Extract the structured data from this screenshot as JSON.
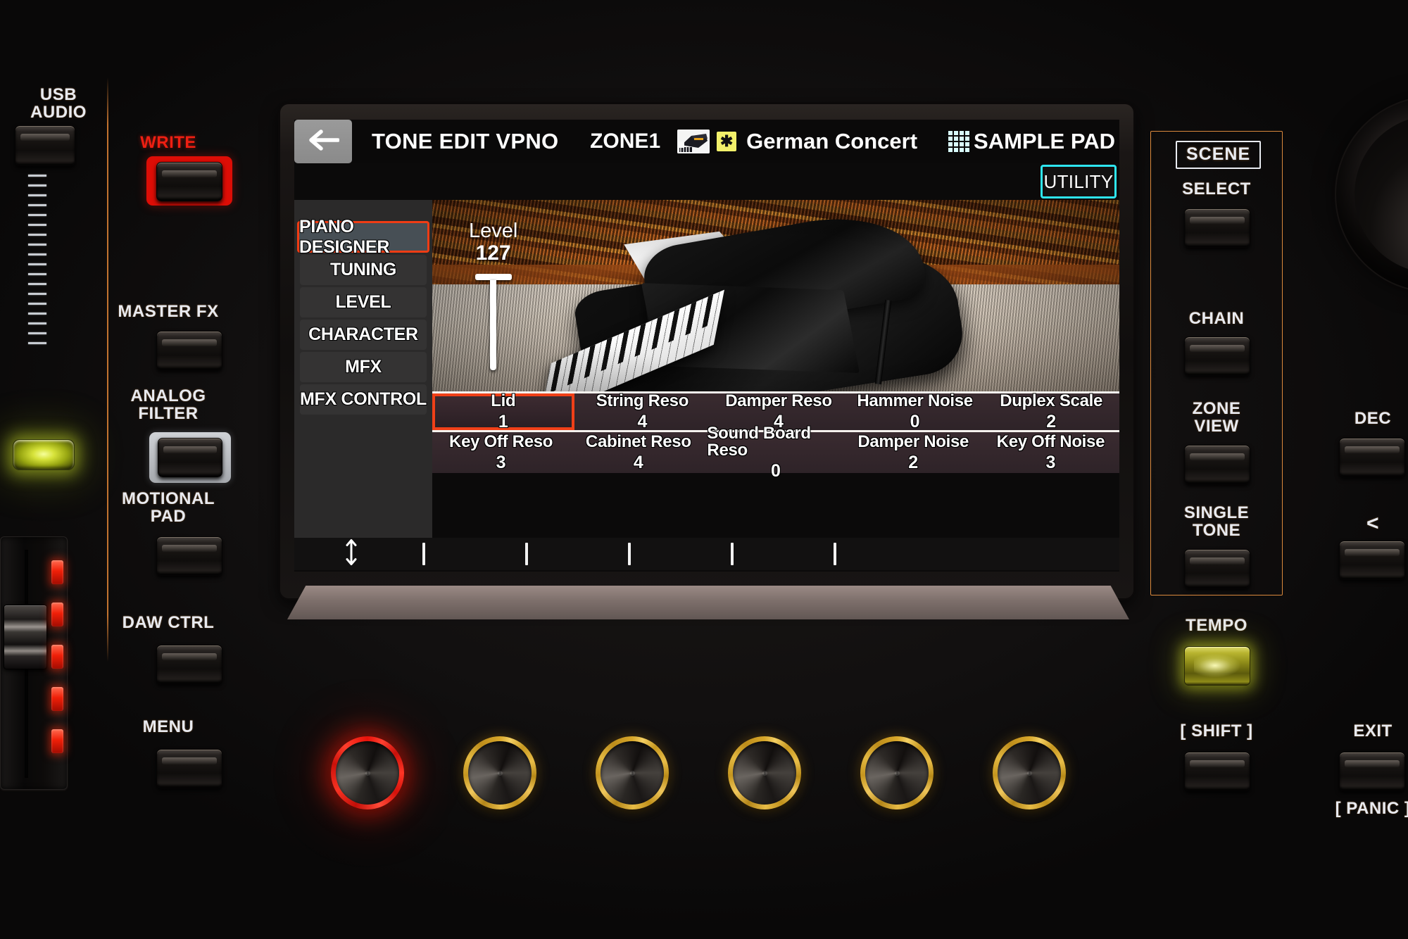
{
  "left_panel": {
    "usb_audio": "USB\nAUDIO",
    "write": "WRITE",
    "master_fx": "MASTER FX",
    "analog_filter": "ANALOG\nFILTER",
    "motional_pad": "MOTIONAL\nPAD",
    "daw_ctrl": "DAW CTRL",
    "menu": "MENU"
  },
  "right_panel": {
    "scene_badge": "SCENE",
    "select": "SELECT",
    "chain": "CHAIN",
    "zone_view": "ZONE\nVIEW",
    "single_tone": "SINGLE\nTONE",
    "tempo": "TEMPO",
    "shift": "[ SHIFT ]",
    "dec": "DEC",
    "left_arrow": "<",
    "exit": "EXIT",
    "panic": "[ PANIC ]"
  },
  "display": {
    "back_icon": "back-arrow-icon",
    "title": "TONE EDIT VPNO",
    "zone": "ZONE1",
    "tone_icon": "piano-tone-icon",
    "star_badge": "✱",
    "tone_name": "German Concert",
    "pad_icon": "sample-pad-grid-icon",
    "pad_label": "SAMPLE PAD",
    "utility": "UTILITY",
    "sidebar": [
      {
        "label": "PIANO DESIGNER",
        "selected": true
      },
      {
        "label": "TUNING",
        "selected": false
      },
      {
        "label": "LEVEL",
        "selected": false
      },
      {
        "label": "CHARACTER",
        "selected": false
      },
      {
        "label": "MFX",
        "selected": false
      },
      {
        "label": "MFX CONTROL",
        "selected": false
      }
    ],
    "level": {
      "label": "Level",
      "value": "127"
    },
    "params": {
      "row1": [
        {
          "name": "Lid",
          "value": "1",
          "selected": true
        },
        {
          "name": "String Reso",
          "value": "4",
          "selected": false
        },
        {
          "name": "Damper Reso",
          "value": "4",
          "selected": false
        },
        {
          "name": "Hammer Noise",
          "value": "0",
          "selected": false
        },
        {
          "name": "Duplex Scale",
          "value": "2",
          "selected": false
        }
      ],
      "row2": [
        {
          "name": "Key Off Reso",
          "value": "3",
          "selected": false
        },
        {
          "name": "Cabinet Reso",
          "value": "4",
          "selected": false
        },
        {
          "name": "Sound Board Reso",
          "value": "0",
          "selected": false
        },
        {
          "name": "Damper Noise",
          "value": "2",
          "selected": false
        },
        {
          "name": "Key Off Noise",
          "value": "3",
          "selected": false
        }
      ]
    },
    "footer_icon": "up-down-arrow-icon"
  },
  "colors": {
    "accent_red": "#f03c14",
    "accent_cyan": "#2ee5f0",
    "panel_orange": "#ffa046",
    "led_yellow": "#c3d728",
    "knob_gold": "#d8a72a",
    "knob_red": "#e8120a"
  }
}
